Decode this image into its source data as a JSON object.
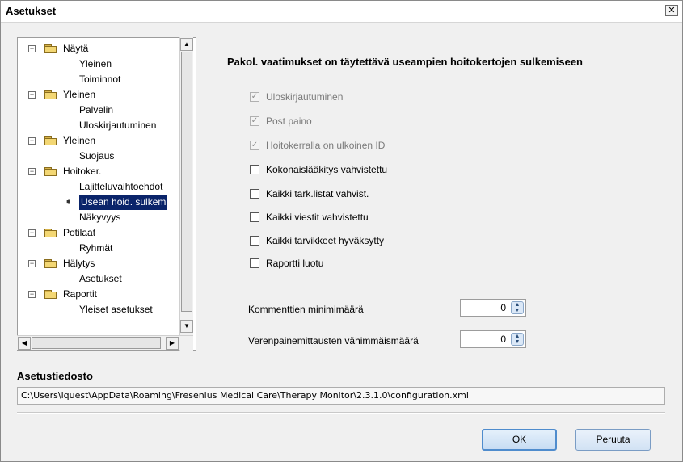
{
  "window": {
    "title": "Asetukset",
    "close_glyph": "✕"
  },
  "tree": {
    "rows": [
      {
        "label": "Näytä",
        "kind": "group",
        "expander": "−"
      },
      {
        "label": "Yleinen",
        "kind": "leaf"
      },
      {
        "label": "Toiminnot",
        "kind": "leaf"
      },
      {
        "label": "Yleinen",
        "kind": "group",
        "expander": "−"
      },
      {
        "label": "Palvelin",
        "kind": "leaf"
      },
      {
        "label": "Uloskirjautuminen",
        "kind": "leaf"
      },
      {
        "label": "Yleinen",
        "kind": "group",
        "expander": "−"
      },
      {
        "label": "Suojaus",
        "kind": "leaf"
      },
      {
        "label": "Hoitoker.",
        "kind": "group",
        "expander": "−"
      },
      {
        "label": "Lajitteluvaihtoehdot",
        "kind": "leaf"
      },
      {
        "label": "Usean hoid. sulkem",
        "kind": "leaf",
        "selected": true,
        "pointer_glyph": "➧"
      },
      {
        "label": "Näkyvyys",
        "kind": "leaf"
      },
      {
        "label": "Potilaat",
        "kind": "group",
        "expander": "−"
      },
      {
        "label": "Ryhmät",
        "kind": "leaf"
      },
      {
        "label": "Hälytys",
        "kind": "group",
        "expander": "−"
      },
      {
        "label": "Asetukset",
        "kind": "leaf"
      },
      {
        "label": "Raportit",
        "kind": "group",
        "expander": "−"
      },
      {
        "label": "Yleiset asetukset",
        "kind": "leaf"
      }
    ],
    "scroll_up_glyph": "▲",
    "scroll_down_glyph": "▼",
    "scroll_left_glyph": "◀",
    "scroll_right_glyph": "▶"
  },
  "main": {
    "heading": "Pakol. vaatimukset on täytettävä useampien hoitokertojen sulkemiseen",
    "checkboxes": [
      {
        "label": "Uloskirjautuminen",
        "checked": true,
        "disabled": true
      },
      {
        "label": "Post paino",
        "checked": true,
        "disabled": true
      },
      {
        "label": "Hoitokerralla on ulkoinen ID",
        "checked": true,
        "disabled": true
      },
      {
        "label": "Kokonaislääkitys vahvistettu",
        "checked": false,
        "disabled": false
      },
      {
        "label": "Kaikki tark.listat vahvist.",
        "checked": false,
        "disabled": false
      },
      {
        "label": "Kaikki viestit vahvistettu",
        "checked": false,
        "disabled": false
      },
      {
        "label": "Kaikki tarvikkeet hyväksytty",
        "checked": false,
        "disabled": false
      },
      {
        "label": "Raportti luotu",
        "checked": false,
        "disabled": false
      }
    ],
    "check_glyph": "✓",
    "numeric_fields": [
      {
        "label": "Kommenttien minimimäärä",
        "value": "0"
      },
      {
        "label": "Verenpainemittausten vähimmäismäärä",
        "value": "0"
      }
    ],
    "spin_glyph_up": "▲",
    "spin_glyph_down": "▼"
  },
  "config_file": {
    "heading": "Asetustiedosto",
    "path": "C:\\Users\\iquest\\AppData\\Roaming\\Fresenius Medical Care\\Therapy Monitor\\2.3.1.0\\configuration.xml"
  },
  "buttons": {
    "ok": "OK",
    "cancel": "Peruuta"
  },
  "icons": {
    "folder": "folder-icon",
    "expander": "minus-box-icon",
    "pointer": "arrow-right-icon"
  }
}
